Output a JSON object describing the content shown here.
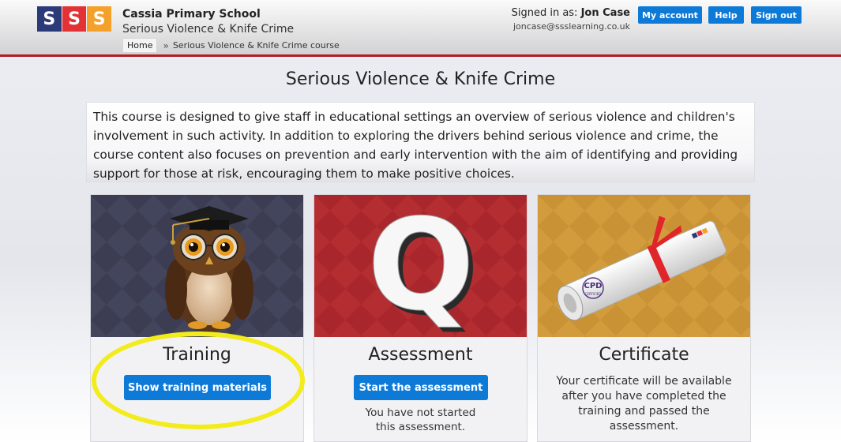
{
  "header": {
    "logo_letters": [
      "S",
      "S",
      "S"
    ],
    "school_name": "Cassia Primary School",
    "course_name": "Serious Violence & Knife Crime",
    "breadcrumb": {
      "home": "Home",
      "separator": "»",
      "current": "Serious Violence & Knife Crime course"
    },
    "signed_in_label": "Signed in as:",
    "user_name": "Jon Case",
    "email": "joncase@ssslearning.co.uk",
    "buttons": {
      "account": "My account",
      "help": "Help",
      "sign_out": "Sign out"
    }
  },
  "main": {
    "title": "Serious Violence & Knife Crime",
    "description": "This course is designed to give staff in educational settings an overview of serious violence and children's involvement in such activity. In addition to exploring the drivers behind serious violence and crime, the course content also focuses on prevention and early intervention with the aim of identifying and providing support for those at risk, encouraging them to make positive choices.",
    "cards": [
      {
        "title": "Training",
        "button": "Show training materials",
        "image": "owl-graduate-icon"
      },
      {
        "title": "Assessment",
        "button": "Start the assessment",
        "note": "You have not started this assessment.",
        "image": "letter-q-icon"
      },
      {
        "title": "Certificate",
        "note": "Your certificate will be available after you have completed the training and passed the assessment.",
        "image": "cpd-scroll-icon",
        "scroll_badge": "CPD",
        "scroll_badge_sub": "CERTIFIED"
      }
    ]
  },
  "colors": {
    "accent_blue": "#0e7ad8",
    "header_rule": "#b01e23",
    "logo_blue": "#2b3a78",
    "logo_red": "#e23235",
    "logo_orange": "#f4a12c",
    "highlight_yellow": "#f3ec1c"
  }
}
